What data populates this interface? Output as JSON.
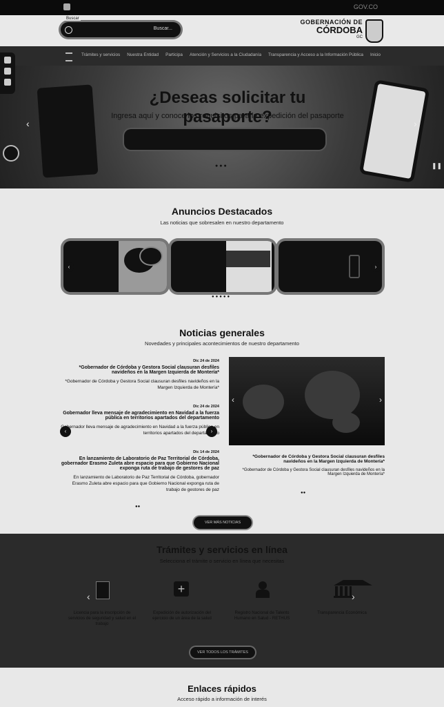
{
  "topbar": {
    "gov": "GOV.CO"
  },
  "header": {
    "search_label": "Buscar",
    "search_placeholder": "Buscar...",
    "logo_line1": "GOBERNACIÓN DE",
    "logo_line2": "CÓRDOBA",
    "logo_line3": "GC"
  },
  "nav": {
    "items": [
      "Inicio",
      "Transparencia y Acceso a la Información Pública",
      "Atención y Servicios a la Ciudadanía",
      "Participa",
      "Nuestra Entidad",
      "Trámites y servicios"
    ]
  },
  "hero": {
    "title": "¿Deseas solicitar tu pasaporte?",
    "subtitle": "Ingresa aquí y conoce los requisitos para la expedición del pasaporte"
  },
  "anuncios": {
    "title": "Anuncios Destacados",
    "subtitle": "Las noticias que sobresalen en nuestro departamento"
  },
  "noticias": {
    "title": "Noticias generales",
    "subtitle": "Novedades y principales acontecimientos de nuestro departamento",
    "items": [
      {
        "date": "Dic 24 de 2024",
        "headline": "*Gobernador de Córdoba y Gestora Social clausuran desfiles navideños en la Margen Izquierda de Montería*",
        "text": "*Gobernador de Córdoba y Gestora Social clausuran desfiles navideños en la Margen Izquierda de Montería*"
      },
      {
        "date": "Dic 24 de 2024",
        "headline": "Gobernador lleva mensaje de agradecimiento en Navidad a la fuerza pública en territorios apartados del departamento",
        "text": "Gobernador lleva mensaje de agradecimiento en Navidad a la fuerza pública en territorios apartados del departamento"
      },
      {
        "date": "Dic 14 de 2024",
        "headline": "En lanzamiento de Laboratorio de Paz Territorial de Córdoba, gobernador Erasmo Zuleta abre espacio para que Gobierno Nacional exponga ruta de trabajo de gestores de paz",
        "text": "En lanzamiento de Laboratorio de Paz Territorial de Córdoba, gobernador Erasmo Zuleta abre espacio para que Gobierno Nacional exponga ruta de trabajo de gestores de paz"
      }
    ],
    "feature_headline": "*Gobernador de Córdoba y Gestora Social clausuran desfiles navideños en la Margen Izquierda de Montería*",
    "feature_text": "*Gobernador de Córdoba y Gestora Social clausuran desfiles navideños en la Margen Izquierda de Montería*",
    "more_button": "VER MÁS NOTICIAS"
  },
  "tramites": {
    "title": "Trámites y servicios en línea",
    "subtitle": "Selecciona el trámite o servicio en línea que necesitas",
    "items": [
      "Licencia para la inscripción de servicios de seguridad y salud en el trabajo",
      "Expedición de autorización del ejercicio de un área de la salud",
      "Registro Nacional de Talento Humano en Salud - RETHUS",
      "Transparencia Económica"
    ],
    "all_button": "VER TODOS LOS TRÁMITES"
  },
  "enlaces": {
    "title": "Enlaces rápidos",
    "subtitle": "Acceso rápido a información de interés"
  }
}
